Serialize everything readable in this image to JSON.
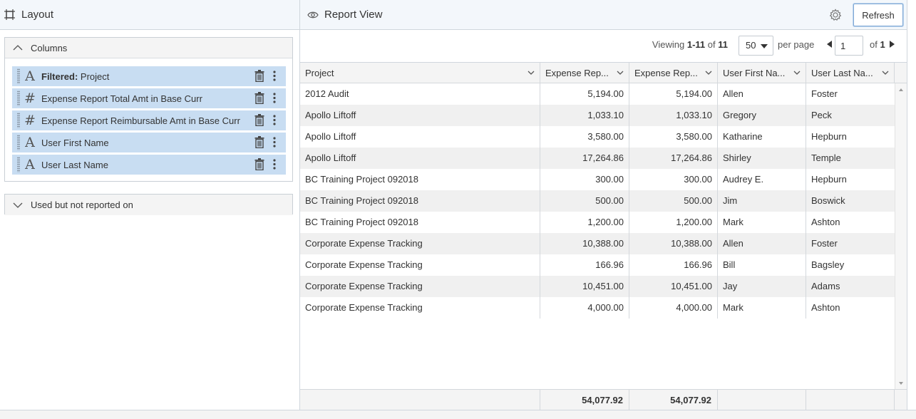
{
  "layout_panel": {
    "title": "Layout",
    "columns_section_label": "Columns",
    "columns": [
      {
        "type_icon": "text-type-icon",
        "prefix": "Filtered:",
        "label": "Project"
      },
      {
        "type_icon": "number-type-icon",
        "prefix": "",
        "label": "Expense Report Total Amt in Base Curr"
      },
      {
        "type_icon": "number-type-icon",
        "prefix": "",
        "label": "Expense Report Reimbursable Amt in Base Curr"
      },
      {
        "type_icon": "text-type-icon",
        "prefix": "",
        "label": "User First Name"
      },
      {
        "type_icon": "text-type-icon",
        "prefix": "",
        "label": "User Last Name"
      }
    ],
    "unused_section_label": "Used but not reported on"
  },
  "report_view": {
    "title": "Report View",
    "refresh_label": "Refresh",
    "pager": {
      "viewing_prefix": "Viewing",
      "range": "1-11",
      "of_word": "of",
      "total": "11",
      "per_page_value": "50",
      "per_page_label": "per page",
      "current_page": "1",
      "of_pages_prefix": "of",
      "total_pages": "1"
    },
    "table": {
      "headers": [
        "Project",
        "Expense Rep...",
        "Expense Rep...",
        "User First Na...",
        "User Last Na..."
      ],
      "rows": [
        [
          "2012 Audit",
          "5,194.00",
          "5,194.00",
          "Allen",
          "Foster"
        ],
        [
          "Apollo Liftoff",
          "1,033.10",
          "1,033.10",
          "Gregory",
          "Peck"
        ],
        [
          "Apollo Liftoff",
          "3,580.00",
          "3,580.00",
          "Katharine",
          "Hepburn"
        ],
        [
          "Apollo Liftoff",
          "17,264.86",
          "17,264.86",
          "Shirley",
          "Temple"
        ],
        [
          "BC Training Project 092018",
          "300.00",
          "300.00",
          "Audrey E.",
          "Hepburn"
        ],
        [
          "BC Training Project 092018",
          "500.00",
          "500.00",
          "Jim",
          "Boswick"
        ],
        [
          "BC Training Project 092018",
          "1,200.00",
          "1,200.00",
          "Mark",
          "Ashton"
        ],
        [
          "Corporate Expense Tracking",
          "10,388.00",
          "10,388.00",
          "Allen",
          "Foster"
        ],
        [
          "Corporate Expense Tracking",
          "166.96",
          "166.96",
          "Bill",
          "Bagsley"
        ],
        [
          "Corporate Expense Tracking",
          "10,451.00",
          "10,451.00",
          "Jay",
          "Adams"
        ],
        [
          "Corporate Expense Tracking",
          "4,000.00",
          "4,000.00",
          "Mark",
          "Ashton"
        ]
      ],
      "totals": [
        "",
        "54,077.92",
        "54,077.92",
        "",
        ""
      ]
    }
  },
  "colors": {
    "header_bg": "#f3f7fb",
    "selected_column_bg": "#c8ddf2",
    "alt_row_bg": "#f0f0f0",
    "refresh_border": "#7fa9d6"
  }
}
